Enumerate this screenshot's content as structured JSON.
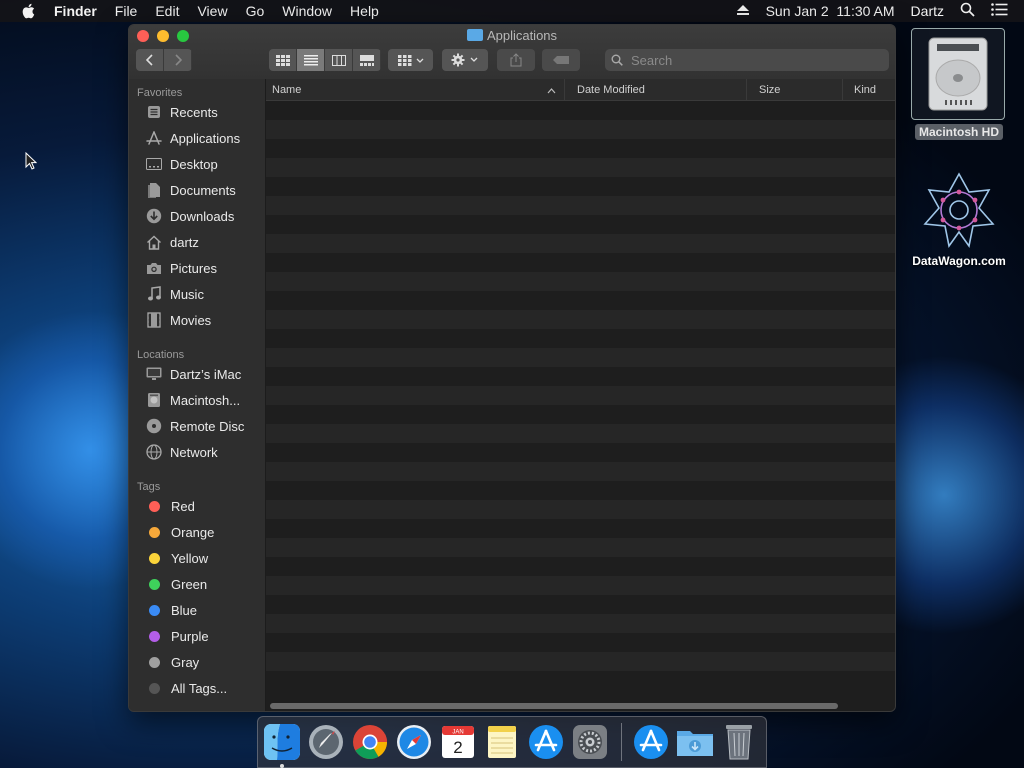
{
  "menubar": {
    "app_name": "Finder",
    "menus": [
      "File",
      "Edit",
      "View",
      "Go",
      "Window",
      "Help"
    ],
    "datetime": "Sun Jan 2  11:30 AM",
    "user": "Dartz"
  },
  "window": {
    "title": "Applications",
    "search_placeholder": "Search",
    "columns": [
      "Name",
      "Date Modified",
      "Size",
      "Kind"
    ]
  },
  "sidebar": {
    "favorites_header": "Favorites",
    "favorites": [
      {
        "label": "Recents",
        "icon": "recents-icon"
      },
      {
        "label": "Applications",
        "icon": "applications-icon"
      },
      {
        "label": "Desktop",
        "icon": "desktop-icon"
      },
      {
        "label": "Documents",
        "icon": "documents-icon"
      },
      {
        "label": "Downloads",
        "icon": "downloads-icon"
      },
      {
        "label": "dartz",
        "icon": "home-icon"
      },
      {
        "label": "Pictures",
        "icon": "camera-icon"
      },
      {
        "label": "Music",
        "icon": "music-note-icon"
      },
      {
        "label": "Movies",
        "icon": "film-icon"
      }
    ],
    "locations_header": "Locations",
    "locations": [
      {
        "label": "Dartz’s iMac",
        "icon": "computer-icon"
      },
      {
        "label": "Macintosh...",
        "icon": "hard-drive-icon"
      },
      {
        "label": "Remote Disc",
        "icon": "disc-icon"
      },
      {
        "label": "Network",
        "icon": "globe-icon"
      }
    ],
    "tags_header": "Tags",
    "tags": [
      {
        "label": "Red",
        "color": "#ff5f57"
      },
      {
        "label": "Orange",
        "color": "#f6a83a"
      },
      {
        "label": "Yellow",
        "color": "#fbd43a"
      },
      {
        "label": "Green",
        "color": "#3ed15b"
      },
      {
        "label": "Blue",
        "color": "#3a8bf5"
      },
      {
        "label": "Purple",
        "color": "#b35ee8"
      },
      {
        "label": "Gray",
        "color": "#a0a0a0"
      },
      {
        "label": "All Tags...",
        "color": "#555555"
      }
    ]
  },
  "desktop": {
    "icons": [
      {
        "label": "Macintosh HD"
      },
      {
        "label": "DataWagon.com"
      }
    ]
  },
  "dock": {
    "apps": [
      "finder-icon",
      "launchpad-icon",
      "chrome-icon",
      "safari-icon",
      "calendar-icon",
      "notes-icon",
      "app-store-icon",
      "system-preferences-icon"
    ],
    "calendar_month": "JAN",
    "calendar_day": "2"
  }
}
